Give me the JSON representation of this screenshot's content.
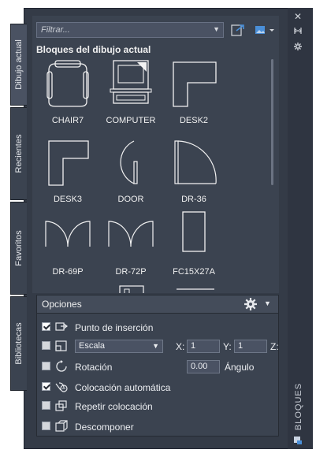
{
  "tabs": [
    {
      "label": "Dibujo actual",
      "active": true
    },
    {
      "label": "Recientes",
      "active": false
    },
    {
      "label": "Favoritos",
      "active": false
    },
    {
      "label": "Bibliotecas",
      "active": false
    }
  ],
  "filter": {
    "placeholder": "Filtrar..."
  },
  "section_title": "Bloques del dibujo actual",
  "blocks": [
    {
      "label": "CHAIR7",
      "icon": "chair-icon"
    },
    {
      "label": "COMPUTER",
      "icon": "computer-icon"
    },
    {
      "label": "DESK2",
      "icon": "desk-icon"
    },
    {
      "label": "DESK3",
      "icon": "desk-icon"
    },
    {
      "label": "DOOR",
      "icon": "door-icon"
    },
    {
      "label": "DR-36",
      "icon": "door-swing-icon"
    },
    {
      "label": "DR-69P",
      "icon": "double-door-icon"
    },
    {
      "label": "DR-72P",
      "icon": "double-door-icon"
    },
    {
      "label": "FC15X27A",
      "icon": "rectangle-block-icon"
    }
  ],
  "options": {
    "title": "Opciones",
    "insertion_point": {
      "label": "Punto de inserción",
      "checked": true
    },
    "scale": {
      "checked": false,
      "mode": "Escala",
      "x_label": "X:",
      "x": "1",
      "y_label": "Y:",
      "y": "1",
      "z_label": "Z:"
    },
    "rotation": {
      "label": "Rotación",
      "checked": false,
      "value": "0.00",
      "angle_label": "Ángulo"
    },
    "auto_placement": {
      "label": "Colocación automática",
      "checked": true
    },
    "repeat_placement": {
      "label": "Repetir colocación",
      "checked": false
    },
    "explode": {
      "label": "Descomponer",
      "checked": false
    }
  },
  "side_label": "BLOQUES",
  "colors": {
    "panel": "#3b4350",
    "frame": "#343b47",
    "accent": "#4a8fd8"
  }
}
